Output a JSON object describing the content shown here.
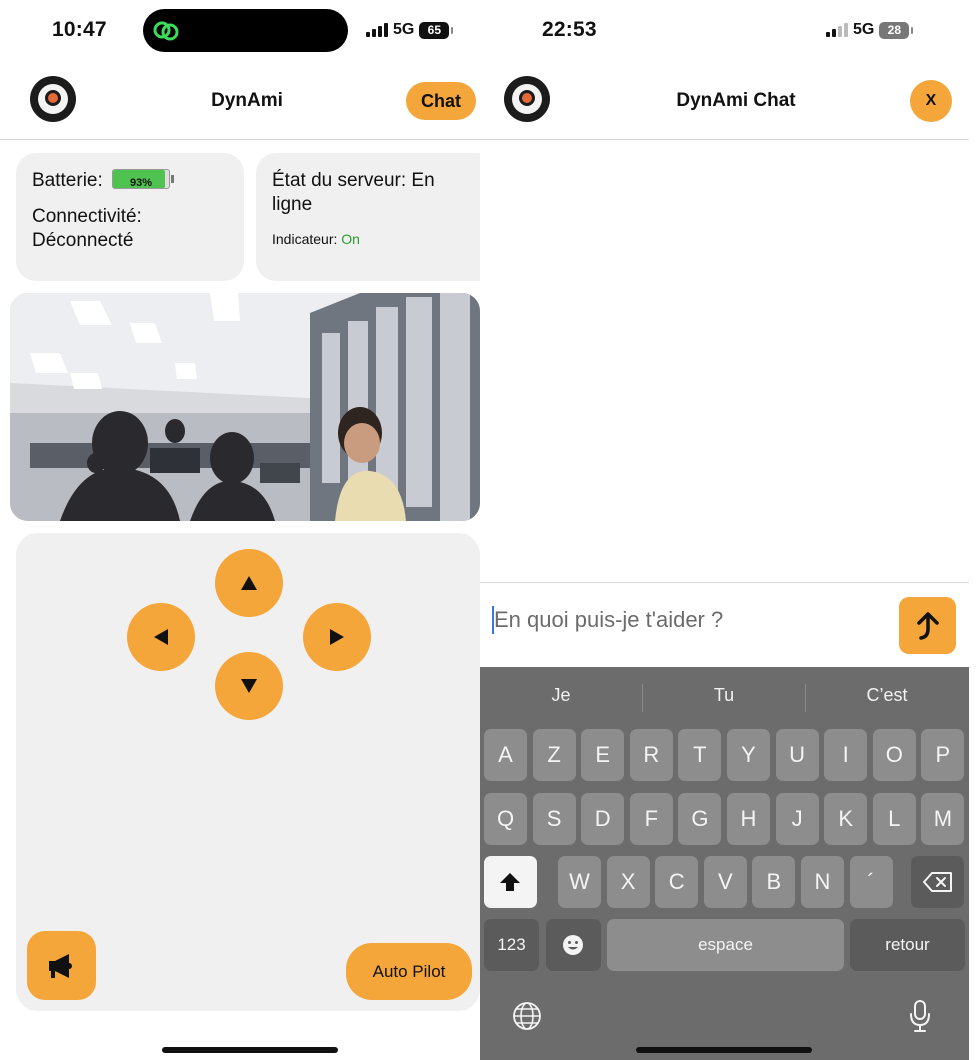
{
  "left": {
    "status": {
      "time": "10:47",
      "network": "5G",
      "battery": "65"
    },
    "header": {
      "title": "DynAmi",
      "chat_label": "Chat"
    },
    "battery_card": {
      "battery_label": "Batterie:",
      "battery_level": "93%",
      "battery_fraction": 0.93,
      "connectivity": "Connectivité: Déconnecté"
    },
    "server_card": {
      "server_status": "État du serveur: En ligne",
      "indicator_label": "Indicateur:",
      "indicator_value": "On"
    },
    "controls": {
      "autopilot_label": "Auto Pilot"
    }
  },
  "right": {
    "status": {
      "time": "22:53",
      "network": "5G",
      "battery": "28"
    },
    "header": {
      "title": "DynAmi Chat",
      "close_label": "X"
    },
    "input": {
      "placeholder": "En quoi puis-je t'aider ?"
    },
    "keyboard": {
      "suggestions": [
        "Je",
        "Tu",
        "C’est"
      ],
      "row1": [
        "A",
        "Z",
        "E",
        "R",
        "T",
        "Y",
        "U",
        "I",
        "O",
        "P"
      ],
      "row2": [
        "Q",
        "S",
        "D",
        "F",
        "G",
        "H",
        "J",
        "K",
        "L",
        "M"
      ],
      "row3": [
        "W",
        "X",
        "C",
        "V",
        "B",
        "N",
        "´"
      ],
      "numbers_label": "123",
      "space_label": "espace",
      "return_label": "retour"
    }
  },
  "colors": {
    "accent": "#f4a63a",
    "card_bg": "#f0f0f0",
    "indicator_on": "#2a9d2a",
    "battery_fill": "#4fc24f",
    "keyboard_bg": "#6c6c6c"
  },
  "icons": [
    "app-link-icon",
    "robot-logo-icon",
    "arrow-up-icon",
    "arrow-left-icon",
    "arrow-right-icon",
    "arrow-down-icon",
    "megaphone-icon",
    "send-arrow-icon",
    "shift-icon",
    "backspace-icon",
    "emoji-icon",
    "globe-icon",
    "microphone-icon"
  ]
}
